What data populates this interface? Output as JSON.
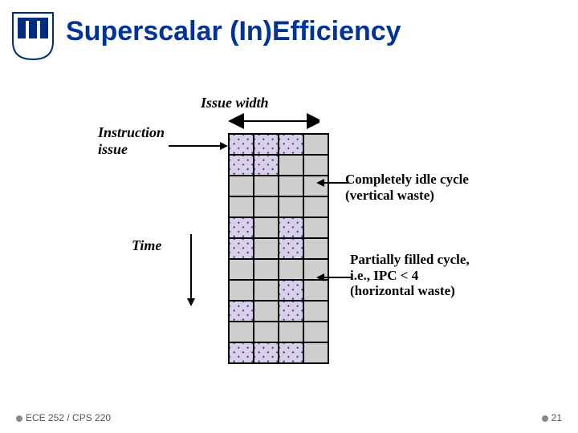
{
  "title": "Superscalar (In)Efficiency",
  "labels": {
    "issue_width": "Issue width",
    "instruction_issue": "Instruction\nissue",
    "time": "Time"
  },
  "annotations": {
    "idle": "Completely idle cycle\n(vertical waste)",
    "partial": "Partially filled cycle,\ni.e., IPC < 4\n(horizontal waste)"
  },
  "footer": {
    "course": "ECE 252 / CPS 220",
    "page": "21"
  },
  "chart_data": {
    "type": "table",
    "title": "Issue grid (4-wide, 11 cycles)",
    "xlabel": "Issue width",
    "ylabel": "Time",
    "issue_width": 4,
    "cycles": 11,
    "filled": [
      [
        1,
        1,
        1,
        0
      ],
      [
        1,
        1,
        0,
        0
      ],
      [
        0,
        0,
        0,
        0
      ],
      [
        0,
        0,
        0,
        0
      ],
      [
        1,
        0,
        1,
        0
      ],
      [
        1,
        0,
        1,
        0
      ],
      [
        0,
        0,
        0,
        0
      ],
      [
        0,
        0,
        1,
        0
      ],
      [
        1,
        0,
        1,
        0
      ],
      [
        0,
        0,
        0,
        0
      ],
      [
        1,
        1,
        1,
        0
      ]
    ],
    "annotations": {
      "vertical_waste_row": 2,
      "horizontal_waste_row": 7
    }
  }
}
